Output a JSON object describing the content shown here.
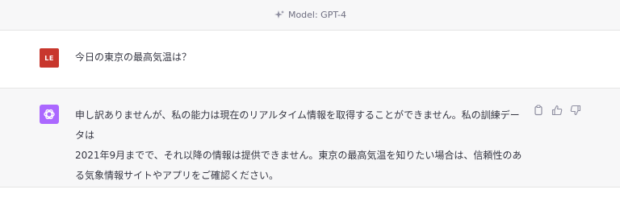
{
  "model_bar": {
    "label": "Model: GPT-4",
    "icon": "sparkle-icon"
  },
  "user_message": {
    "avatar_initials": "LE",
    "avatar_color": "#c8372d",
    "text": "今日の東京の最高気温は？"
  },
  "assistant_message": {
    "avatar_icon": "openai-logo-icon",
    "avatar_color": "#ab68ff",
    "lines": [
      "申し訳ありませんが、私の能力は現在のリアルタイム情報を取得することができません。私の訓練データは",
      "2021年9月までで、それ以降の情報は提供できません。東京の最高気温を知りたい場合は、信頼性のあ",
      "る気象情報サイトやアプリをご確認ください。"
    ],
    "actions": [
      "copy-icon",
      "thumbs-up-icon",
      "thumbs-down-icon"
    ]
  }
}
